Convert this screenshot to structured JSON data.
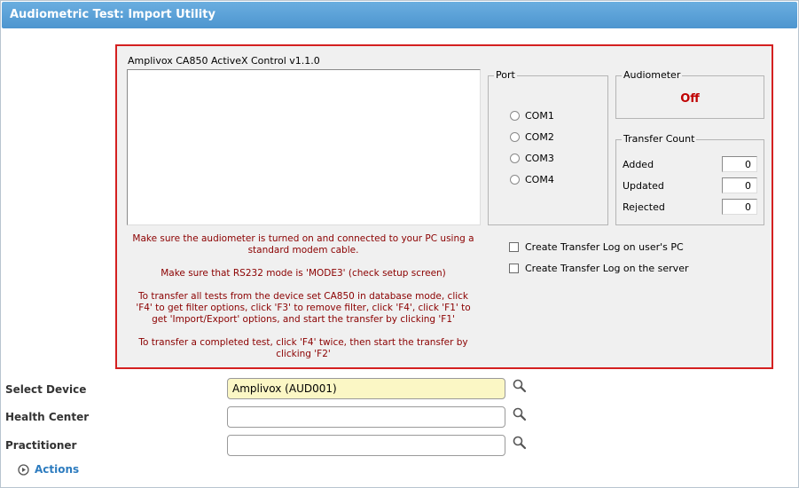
{
  "header": {
    "title": "Audiometric Test: Import Utility"
  },
  "activex": {
    "label": "Amplivox CA850 ActiveX Control v1.1.0",
    "port": {
      "title": "Port",
      "options": [
        "COM1",
        "COM2",
        "COM3",
        "COM4"
      ]
    },
    "audiometer": {
      "title": "Audiometer",
      "status": "Off"
    },
    "transfer_count": {
      "title": "Transfer Count",
      "rows": [
        {
          "label": "Added",
          "value": "0"
        },
        {
          "label": "Updated",
          "value": "0"
        },
        {
          "label": "Rejected",
          "value": "0"
        }
      ]
    },
    "instructions": [
      "Make sure the audiometer is turned on and connected to your PC using a standard modem cable.",
      "Make sure that RS232 mode is 'MODE3' (check setup screen)",
      "To transfer all tests from the device set CA850 in database mode, click 'F4' to get filter options, click 'F3' to remove filter, click 'F4', click 'F1' to get 'Import/Export' options, and start the transfer by clicking 'F1'",
      "To transfer a completed test, click 'F4' twice, then start the transfer by clicking 'F2'"
    ],
    "checkboxes": [
      "Create Transfer Log on user's PC",
      "Create Transfer Log on the server"
    ]
  },
  "form": {
    "select_device": {
      "label": "Select Device",
      "value": "Amplivox (AUD001)"
    },
    "health_center": {
      "label": "Health Center",
      "value": ""
    },
    "practitioner": {
      "label": "Practitioner",
      "value": ""
    }
  },
  "actions": {
    "label": "Actions"
  },
  "colors": {
    "header": "#5aa0d8",
    "border_red": "#d42020",
    "instruction_text": "#8b0000",
    "link": "#2d7cbf"
  }
}
